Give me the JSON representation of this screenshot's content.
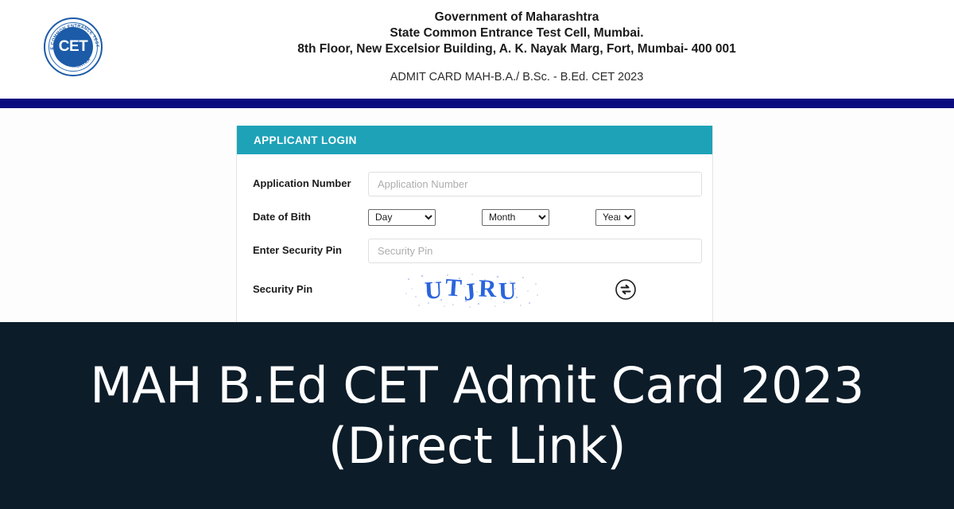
{
  "header": {
    "logo": {
      "center_text": "CET",
      "ring_text_top": "STATE COMMON ENTRANCE TEST CELL",
      "ring_text_bottom": "MAHARASHTRA"
    },
    "line1": "Government of Maharashtra",
    "line2": "State Common Entrance Test Cell, Mumbai.",
    "line3": "8th Floor, New Excelsior Building, A. K. Nayak Marg, Fort, Mumbai- 400 001",
    "subtitle": "ADMIT CARD MAH-B.A./ B.Sc. - B.Ed. CET 2023"
  },
  "login_panel": {
    "title": "APPLICANT LOGIN",
    "fields": {
      "application_number": {
        "label": "Application Number",
        "placeholder": "Application Number",
        "value": ""
      },
      "date_of_birth": {
        "label": "Date of Bith",
        "day": {
          "selected": "Day",
          "options": [
            "Day"
          ]
        },
        "month": {
          "selected": "Month",
          "options": [
            "Month"
          ]
        },
        "year": {
          "selected": "Year",
          "options": [
            "Year"
          ]
        }
      },
      "enter_security_pin": {
        "label": "Enter Security Pin",
        "placeholder": "Security Pin",
        "value": ""
      },
      "security_pin": {
        "label": "Security Pin",
        "captcha_text": "UTJRU",
        "refresh_icon": "refresh-icon"
      }
    }
  },
  "banner": {
    "line1": "MAH B.Ed CET Admit Card 2023",
    "line2": "(Direct Link)"
  },
  "colors": {
    "navy_bar": "#0b0b80",
    "panel_header": "#1da2b8",
    "banner_background": "#0c1c29",
    "logo_blue": "#1b5ba8",
    "captcha_blue": "#2a64dd"
  }
}
